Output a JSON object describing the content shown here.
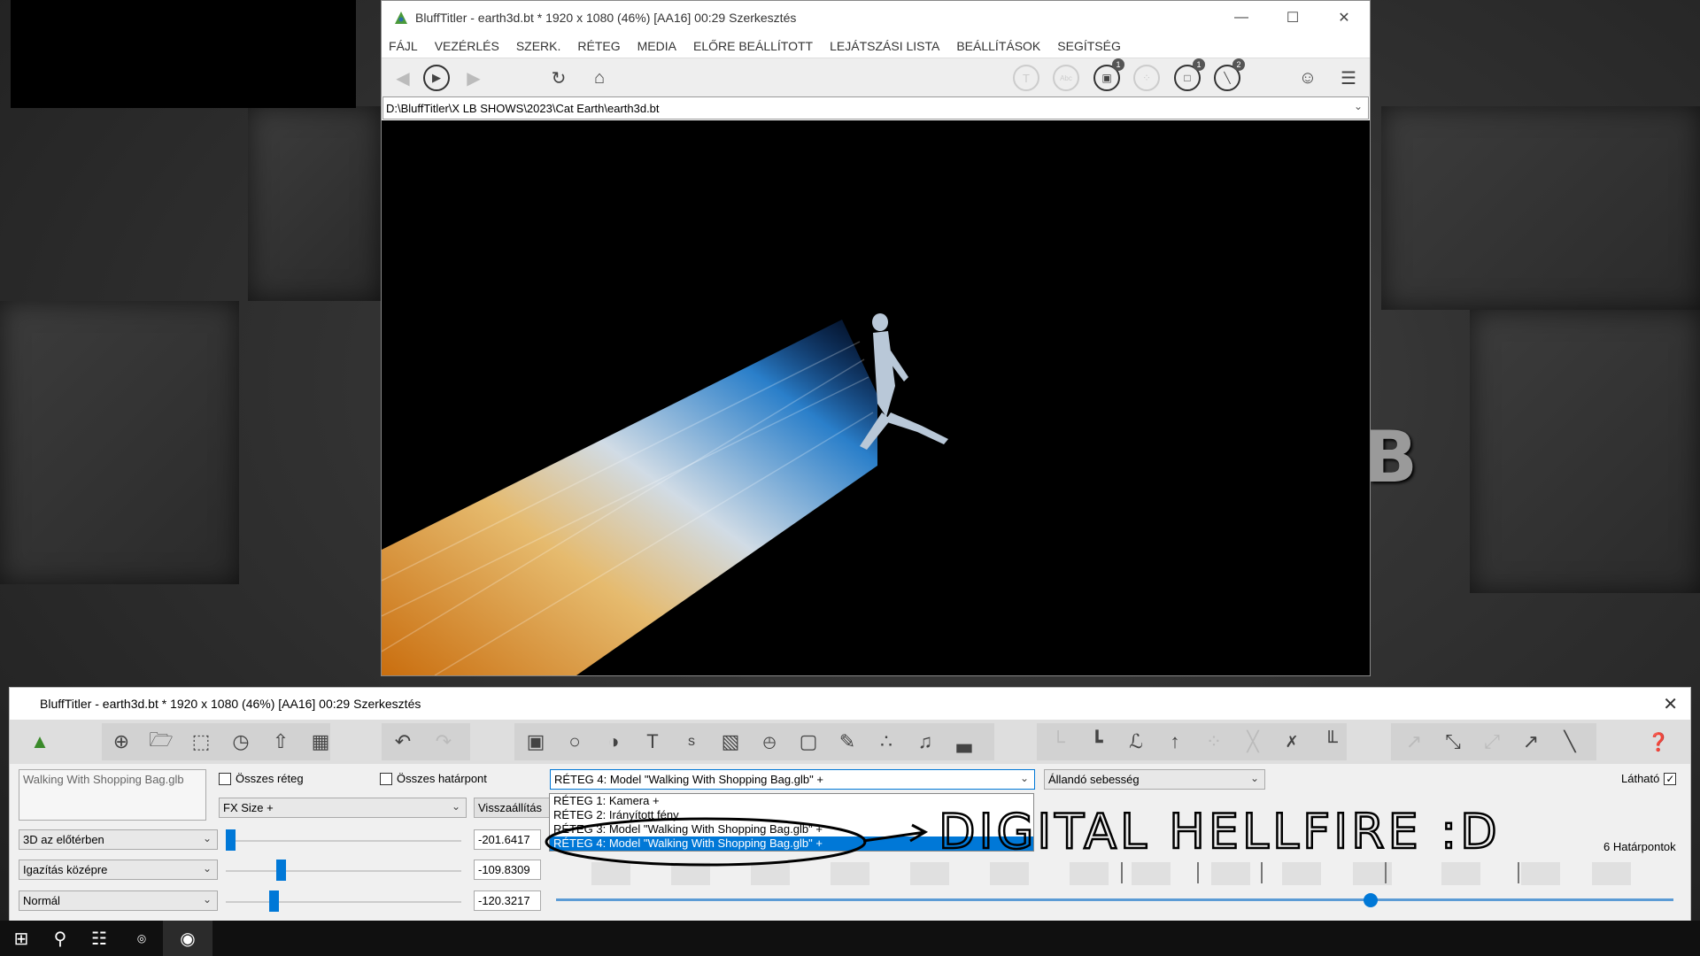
{
  "window": {
    "title": "BluffTitler - earth3d.bt * 1920 x 1080 (46%) [AA16] 00:29 Szerkesztés",
    "menu": [
      "FÁJL",
      "VEZÉRLÉS",
      "SZERK.",
      "RÉTEG",
      "MEDIA",
      "ELŐRE BEÁLLÍTOTT",
      "LEJÁTSZÁSI LISTA",
      "BEÁLLÍTÁSOK",
      "SEGÍTSÉG"
    ],
    "path": "D:\\BluffTitler\\X LB SHOWS\\2023\\Cat Earth\\earth3d.bt",
    "badges": [
      "1",
      "1",
      "2"
    ]
  },
  "panel": {
    "title": "BluffTitler - earth3d.bt * 1920 x 1080 (46%) [AA16] 00:29 Szerkesztés",
    "layer_name": "Walking With Shopping Bag.glb",
    "all_layers": "Összes réteg",
    "all_keys": "Összes határpont",
    "layer_select": "RÉTEG 4: Model \"Walking With Shopping Bag.glb\" +",
    "speed_select": "Állandó sebesség",
    "visible": "Látható",
    "fx_select": "FX Size +",
    "reset": "Visszaállítás",
    "mode1": "3D az előtérben",
    "mode2": "Igazítás középre",
    "mode3": "Normál",
    "val1": "-201.6417",
    "val2": "-109.8309",
    "val3": "-120.3217",
    "keys": "6 Határpontok",
    "dropdown": [
      "RÉTEG 1: Kamera +",
      "RÉTEG 2: Irányított fény",
      "RÉTEG 3: Model \"Walking With Shopping Bag.glb\" +",
      "RÉTEG 4: Model \"Walking With Shopping Bag.glb\" +"
    ]
  },
  "annotation": "DIGITAL HELLFIRE :D",
  "big_letter": "B",
  "colors": {
    "accent": "#0078d7"
  }
}
